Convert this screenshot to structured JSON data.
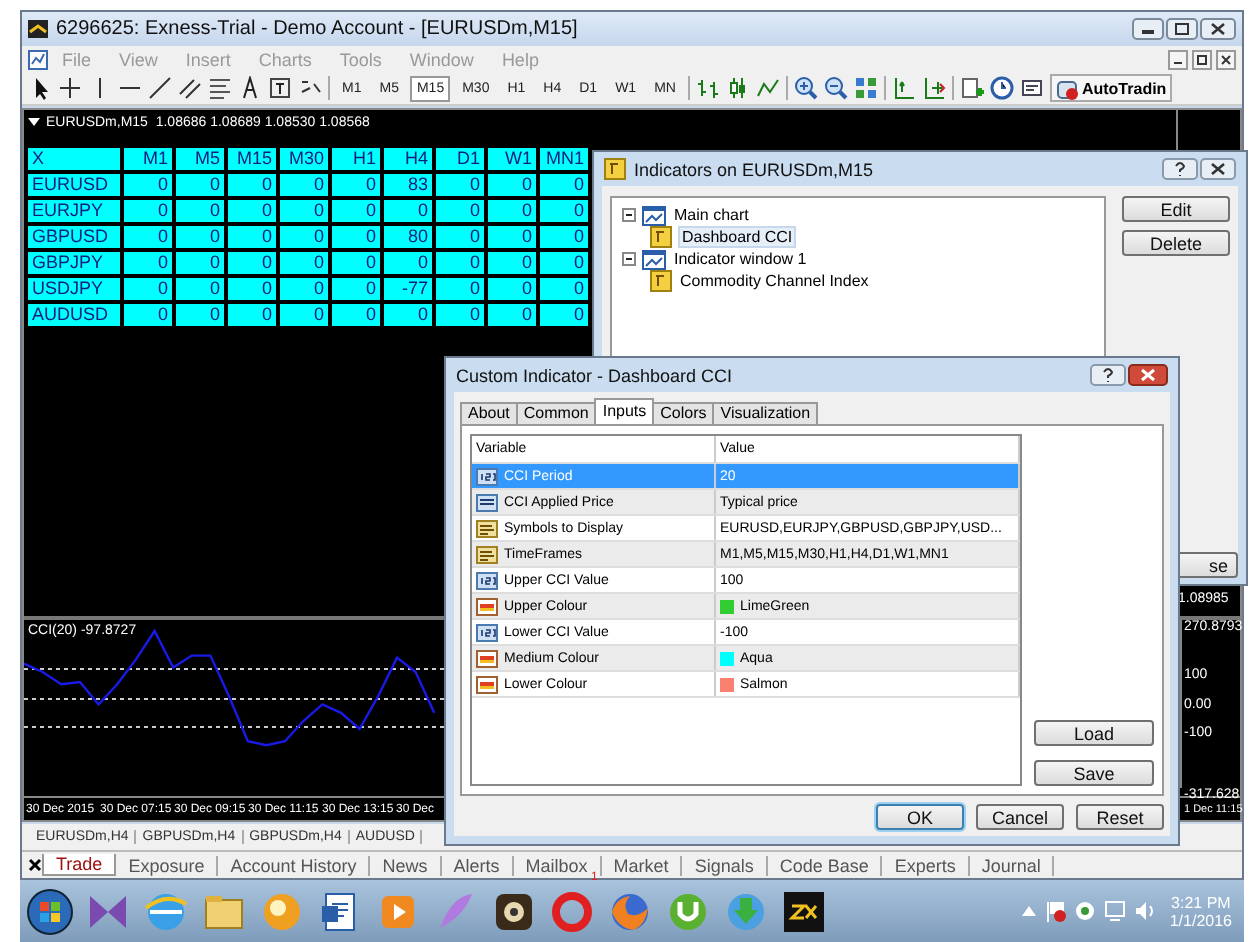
{
  "window": {
    "title": "6296625: Exness-Trial - Demo Account - [EURUSDm,M15]"
  },
  "menu": [
    "File",
    "View",
    "Insert",
    "Charts",
    "Tools",
    "Window",
    "Help"
  ],
  "toolbar": {
    "periods": [
      {
        "label": "M1",
        "selected": false
      },
      {
        "label": "M5",
        "selected": false
      },
      {
        "label": "M15",
        "selected": true
      },
      {
        "label": "M30",
        "selected": false
      },
      {
        "label": "H1",
        "selected": false
      },
      {
        "label": "H4",
        "selected": false
      },
      {
        "label": "D1",
        "selected": false
      },
      {
        "label": "W1",
        "selected": false
      },
      {
        "label": "MN",
        "selected": false
      }
    ],
    "autotrading": "AutoTradin"
  },
  "chart": {
    "header": "EURUSDm,M15  1.08686 1.08689 1.08530 1.08568",
    "dashboard": {
      "columns": [
        "X",
        "M1",
        "M5",
        "M15",
        "M30",
        "H1",
        "H4",
        "D1",
        "W1",
        "MN1"
      ],
      "rows": [
        {
          "symbol": "EURUSD",
          "values": [
            "0",
            "0",
            "0",
            "0",
            "0",
            "83",
            "0",
            "0",
            "0"
          ]
        },
        {
          "symbol": "EURJPY",
          "values": [
            "0",
            "0",
            "0",
            "0",
            "0",
            "0",
            "0",
            "0",
            "0"
          ]
        },
        {
          "symbol": "GBPUSD",
          "values": [
            "0",
            "0",
            "0",
            "0",
            "0",
            "80",
            "0",
            "0",
            "0"
          ]
        },
        {
          "symbol": "GBPJPY",
          "values": [
            "0",
            "0",
            "0",
            "0",
            "0",
            "0",
            "0",
            "0",
            "0"
          ]
        },
        {
          "symbol": "USDJPY",
          "values": [
            "0",
            "0",
            "0",
            "0",
            "0",
            "-77",
            "0",
            "0",
            "0"
          ]
        },
        {
          "symbol": "AUDUSD",
          "values": [
            "0",
            "0",
            "0",
            "0",
            "0",
            "0",
            "0",
            "0",
            "0"
          ]
        }
      ]
    },
    "price_axis_label": "1.08985",
    "indicator_window": {
      "label": "CCI(20) -97.8727",
      "chart_data": {
        "type": "line",
        "grid": true,
        "ylim": [
          -317.628,
          270.8793
        ],
        "yticks": [
          {
            "value": 270.8793,
            "label": "270.8793"
          },
          100,
          {
            "value": 0,
            "label": "0.00"
          },
          -100,
          {
            "value": -317.628,
            "label": "-317.628"
          }
        ],
        "series": [
          {
            "color": "#1a1ae8",
            "values": [
              118,
              89,
              46,
              54,
              -25,
              46,
              132,
              232,
              104,
              146,
              146,
              4,
              -154,
              -168,
              -154,
              -82,
              -25,
              -54,
              -111,
              4,
              139,
              89,
              -54,
              null,
              null,
              null,
              null,
              null,
              null,
              null,
              null,
              null,
              null,
              null,
              null,
              null,
              null,
              null,
              null,
              null,
              null,
              null,
              null,
              null,
              null,
              null,
              null,
              null,
              null,
              null,
              null,
              null,
              null,
              null,
              null,
              null,
              null,
              null,
              null,
              null,
              null,
              null,
              null
            ]
          }
        ]
      }
    },
    "time_axis": [
      "30 Dec 2015",
      "30 Dec 07:15",
      "30 Dec 09:15",
      "30 Dec 11:15",
      "30 Dec 13:15",
      "30 Dec"
    ],
    "time_axis_right": "1 Dec 11:15"
  },
  "chart_tabs": [
    "EURUSDm,H4",
    "GBPUSDm,H4",
    "GBPUSDm,H4",
    "AUDUSD"
  ],
  "indicators_dialog": {
    "title": "Indicators on EURUSDm,M15",
    "tree": [
      {
        "label": "Main chart",
        "expanded": true,
        "children": [
          {
            "label": "Dashboard CCI",
            "selected": true
          }
        ]
      },
      {
        "label": "Indicator window 1",
        "expanded": true,
        "children": [
          {
            "label": "Commodity Channel Index",
            "selected": false
          }
        ]
      }
    ],
    "buttons": [
      "Edit",
      "Delete"
    ],
    "close_button": "se"
  },
  "custom_indicator_dialog": {
    "title": "Custom Indicator - Dashboard CCI",
    "tabs": [
      {
        "label": "About",
        "selected": false
      },
      {
        "label": "Common",
        "selected": false
      },
      {
        "label": "Inputs",
        "selected": true
      },
      {
        "label": "Colors",
        "selected": false
      },
      {
        "label": "Visualization",
        "selected": false
      }
    ],
    "inputs": {
      "columns": [
        "Variable",
        "Value"
      ],
      "rows": [
        {
          "kind": "number",
          "variable": "CCI Period",
          "value": "20",
          "selected": true
        },
        {
          "kind": "list",
          "variable": "CCI Applied Price",
          "value": "Typical price",
          "selected": false
        },
        {
          "kind": "text",
          "variable": "Symbols to Display",
          "value": "EURUSD,EURJPY,GBPUSD,GBPJPY,USD...",
          "selected": false
        },
        {
          "kind": "text",
          "variable": "TimeFrames",
          "value": "M1,M5,M15,M30,H1,H4,D1,W1,MN1",
          "selected": false
        },
        {
          "kind": "number",
          "variable": "Upper CCI Value",
          "value": "100",
          "selected": false
        },
        {
          "kind": "color",
          "variable": "Upper Colour",
          "value": "LimeGreen",
          "color": "#32cd32",
          "selected": false
        },
        {
          "kind": "number",
          "variable": "Lower CCI Value",
          "value": "-100",
          "selected": false
        },
        {
          "kind": "color",
          "variable": "Medium Colour",
          "value": "Aqua",
          "color": "#00ffff",
          "selected": false
        },
        {
          "kind": "color",
          "variable": "Lower Colour",
          "value": "Salmon",
          "color": "#fa8072",
          "selected": false
        }
      ]
    },
    "side_buttons": [
      "Load",
      "Save"
    ],
    "buttons": [
      "OK",
      "Cancel",
      "Reset"
    ]
  },
  "terminal_tabs": [
    {
      "label": "Trade",
      "selected": true
    },
    {
      "label": "Exposure",
      "selected": false
    },
    {
      "label": "Account History",
      "selected": false
    },
    {
      "label": "News",
      "selected": false
    },
    {
      "label": "Alerts",
      "selected": false
    },
    {
      "label": "Mailbox",
      "selected": false,
      "badge": "1"
    },
    {
      "label": "Market",
      "selected": false
    },
    {
      "label": "Signals",
      "selected": false
    },
    {
      "label": "Code Base",
      "selected": false
    },
    {
      "label": "Experts",
      "selected": false
    },
    {
      "label": "Journal",
      "selected": false
    }
  ],
  "taskbar": {
    "time": "3:21 PM",
    "date": "1/1/2016"
  }
}
